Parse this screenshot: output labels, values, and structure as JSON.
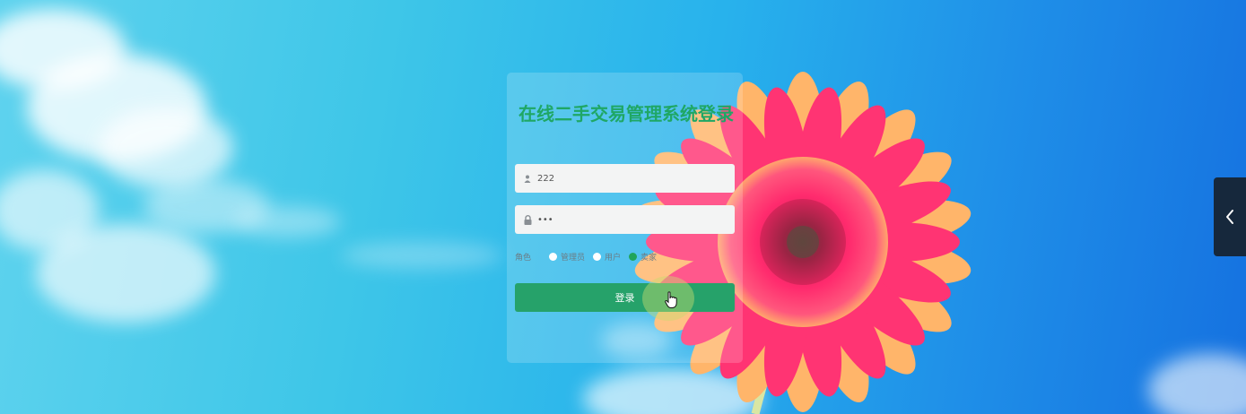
{
  "login": {
    "title": "在线二手交易管理系统登录",
    "username": {
      "value": "222",
      "icon": "user-icon"
    },
    "password": {
      "value": "•••",
      "icon": "lock-icon"
    },
    "role": {
      "label": "角色",
      "options": [
        "管理员",
        "用户",
        "卖家"
      ],
      "selected": "卖家"
    },
    "submit_label": "登录"
  },
  "side_panel": {
    "icon": "chevron-left-icon"
  },
  "colors": {
    "title": "#1fa765",
    "button": "#26a26a",
    "radio_selected": "#20a45c",
    "side_toggle": "#16283c"
  }
}
